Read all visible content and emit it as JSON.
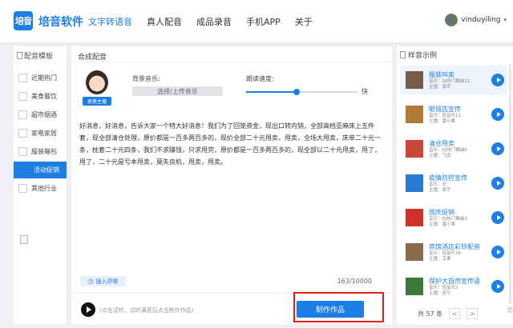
{
  "app": {
    "name": "培音软件",
    "logo_text": "培音"
  },
  "nav": {
    "items": [
      "文字转语音",
      "真人配音",
      "成品录音",
      "手机APP",
      "关于"
    ],
    "active": 0
  },
  "user": {
    "name": "vinduyiling"
  },
  "left": {
    "header": "配音模板",
    "categories": [
      "近期热门",
      "美食餐饮",
      "超市烟酒",
      "家电家居",
      "服装箱包",
      "活动促销",
      "其他行业"
    ],
    "active": 5
  },
  "main": {
    "panel_title": "合成配音",
    "change_voice": "更换主播",
    "bg_music_label": "背景音乐:",
    "bg_music_select": "选择/上传音乐",
    "speed_label": "朗读速度:",
    "speed_fast": "快",
    "speed_value": 0.45,
    "text": "好消息，好消息，告诉大家一个特大好消息！我们为了回笼资金，现出口转内销，全部高档亚麻床上五件套，现全部清仓处理，原价都是一百多两百多的，现价全部二十元甩卖，甩卖，全场大甩卖，床单二十元一条，枕套二十元四条，我们不求赚钱，只求甩完，原价都是一百多两百多的，现全部以二十元甩卖，甩了，甩了，二十元是亏本甩卖，莫失良机，甩卖，甩卖。",
    "insert_pause": "插入停顿",
    "char_count": "163/10000",
    "hint": "(点击试听，试听满意后点击制作作品)",
    "make_button": "制作作品"
  },
  "right": {
    "header": "样音示例",
    "samples": [
      {
        "title": "服装叫卖",
        "music": "音乐：DJ热门舞曲11",
        "host": "主播：承宇"
      },
      {
        "title": "眼镜店宣传",
        "music": "音乐：轻音乐11",
        "host": "主播：香小果"
      },
      {
        "title": "清仓甩卖",
        "music": "音乐：DJ热门舞曲6",
        "host": "主播：飞龙"
      },
      {
        "title": "疫情防控宣传",
        "music": "音乐：无",
        "host": "主播：承宇"
      },
      {
        "title": "国庆促销",
        "music": "音乐：DJ热门舞曲3",
        "host": "主播：香小果"
      },
      {
        "title": "宾馆酒店彩铃配音",
        "music": "音乐：轻音乐34",
        "host": "主播：艾果"
      },
      {
        "title": "保护大自然宣传语",
        "music": "音乐：轻音乐2",
        "host": "主播：若兮"
      }
    ],
    "selected": 0,
    "total": "共 57 条",
    "prev": "<",
    "next": ">",
    "watermark": "激"
  },
  "colors": {
    "accent": "#1d7ee6",
    "highlight_border": "#e02020"
  }
}
